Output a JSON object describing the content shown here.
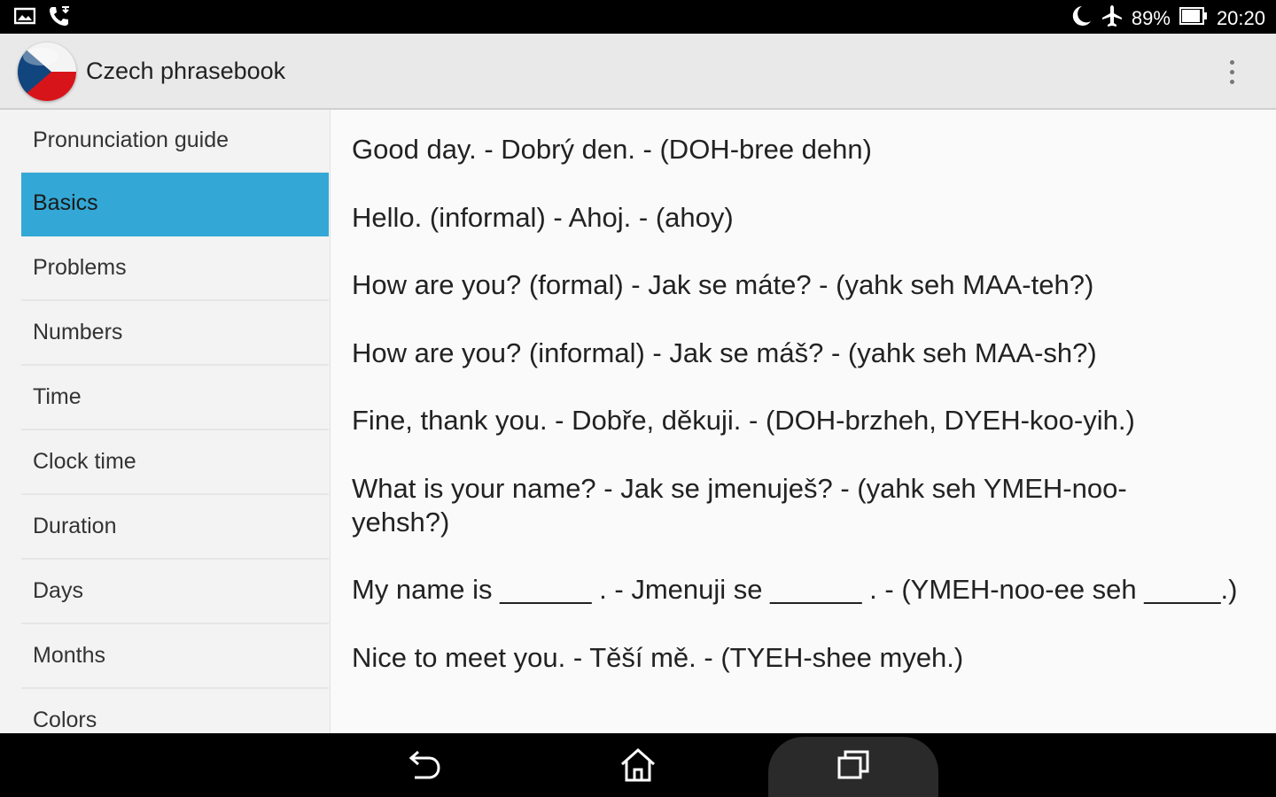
{
  "status": {
    "battery": "89%",
    "time": "20:20",
    "left_icons": [
      "image-icon",
      "phone-call-icon"
    ],
    "right_icons": [
      "moon-icon",
      "airplane-icon",
      "battery-icon"
    ]
  },
  "app": {
    "title": "Czech phrasebook",
    "menu_icon": "overflow-menu-icon"
  },
  "sidebar": {
    "items": [
      {
        "label": "Pronunciation guide",
        "active": false
      },
      {
        "label": "Basics",
        "active": true
      },
      {
        "label": "Problems",
        "active": false
      },
      {
        "label": "Numbers",
        "active": false
      },
      {
        "label": "Time",
        "active": false
      },
      {
        "label": "Clock time",
        "active": false
      },
      {
        "label": "Duration",
        "active": false
      },
      {
        "label": "Days",
        "active": false
      },
      {
        "label": "Months",
        "active": false
      },
      {
        "label": "Colors",
        "active": false
      }
    ],
    "active_color": "#33a8d6"
  },
  "phrases": [
    "Good day. - Dobrý den. - (DOH-bree dehn)",
    "Hello. (informal) - Ahoj. - (ahoy)",
    "How are you? (formal) - Jak se máte? - (yahk seh MAA-teh?)",
    "How are you? (informal) - Jak se máš? - (yahk seh MAA-sh?)",
    "Fine, thank you. - Dobře, děkuji. - (DOH-brzheh, DYEH-koo-yih.)",
    "What is your name? - Jak se jmenuješ? - (yahk seh YMEH-noo-yehsh?)",
    "My name is ______ . - Jmenuji se ______ . - (YMEH-noo-ee seh _____.)",
    "Nice to meet you. - Těší mě. - (TYEH-shee myeh.)"
  ],
  "nav": {
    "buttons": [
      "back-icon",
      "home-icon",
      "recents-icon"
    ]
  }
}
